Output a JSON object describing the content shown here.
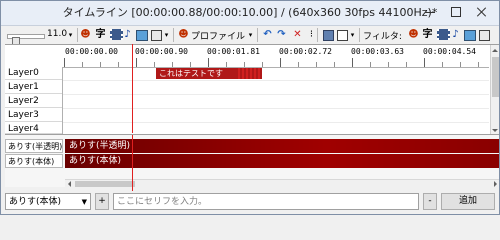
{
  "window": {
    "title": "タイムライン [00:00:00.88/00:00:10.00] / (640x360 30fps 44100Hz)*"
  },
  "toolbar": {
    "zoom_value": "11.0",
    "char_icon": "字",
    "profile_label": "プロファイル",
    "filter_label": "フィルタ:",
    "filter_char_icon": "字"
  },
  "ruler": {
    "ticks": [
      "00:00:00.00",
      "00:00:00.90",
      "00:00:01.81",
      "00:00:02.72",
      "00:00:03.63",
      "00:00:04.54"
    ]
  },
  "layers": [
    "Layer0",
    "Layer1",
    "Layer2",
    "Layer3",
    "Layer4"
  ],
  "clip": {
    "text": "これはテストです"
  },
  "voice": {
    "tracks": [
      {
        "label": "ありす(半透明)",
        "bar_text": "ありす(半透明)"
      },
      {
        "label": "ありす(本体)",
        "bar_text": "ありす(本体)"
      }
    ]
  },
  "bottom": {
    "character": "ありす(本体)",
    "plus_label": "+",
    "input_placeholder": "ここにセリフを入力。",
    "minus_label": "-",
    "add_label": "追加"
  },
  "colors": {
    "clip": "#b01818",
    "voice_bar": "#8a0000",
    "cursor": "#e02020"
  }
}
